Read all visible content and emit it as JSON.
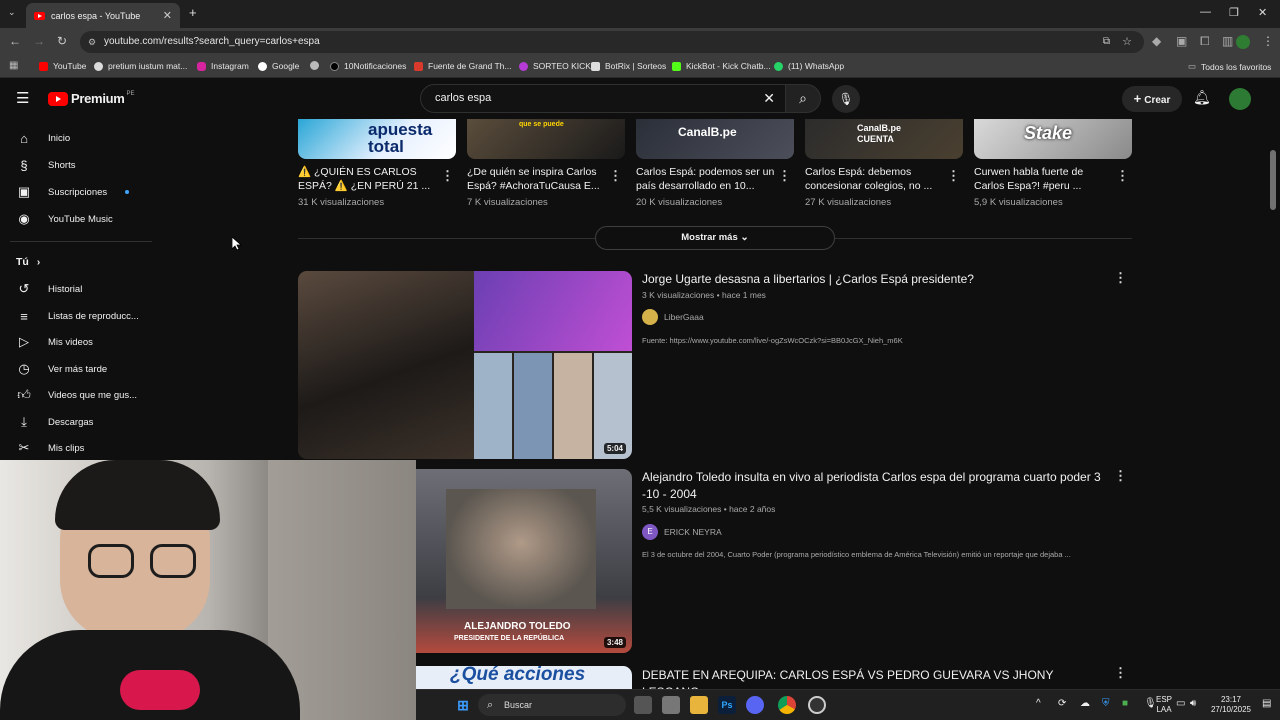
{
  "browser": {
    "tab_title": "carlos espa - YouTube",
    "url": "youtube.com/results?search_query=carlos+espa",
    "bookmarks": [
      "YouTube",
      "pretium iustum mat...",
      "Instagram",
      "Google",
      "10Notificaciones",
      "Fuente de Grand Th...",
      "SORTEO KICK",
      "BotRix | Sorteos",
      "KickBot - Kick Chatb...",
      "(11) WhatsApp"
    ],
    "all_bookmarks": "Todos los favoritos"
  },
  "youtube": {
    "logo": "Premium",
    "region": "PE",
    "search_query": "carlos espa",
    "create_label": "Crear",
    "sidebar": {
      "main": [
        "Inicio",
        "Shorts",
        "Suscripciones",
        "YouTube Music"
      ],
      "you_label": "Tú",
      "you_items": [
        "Historial",
        "Listas de reproducc...",
        "Mis videos",
        "Ver más tarde",
        "Videos que me gus...",
        "Descargas",
        "Mis clips"
      ]
    },
    "shelf": [
      {
        "title": "⚠️ ¿QUIÉN ES CARLOS ESPÁ? ⚠️ ¿EN PERÚ 21 ...",
        "views": "31 K visualizaciones",
        "thumb_text": "apuesta total"
      },
      {
        "title": "¿De quién se inspira Carlos Espá? #AchoraTuCausa E...",
        "views": "7 K visualizaciones",
        "thumb_text": "que se puede"
      },
      {
        "title": "Carlos Espá: podemos ser un país desarrollado en 10...",
        "views": "20 K visualizaciones",
        "thumb_text": "CanalB.pe"
      },
      {
        "title": "Carlos Espá: debemos concesionar colegios, no ...",
        "views": "27 K visualizaciones",
        "thumb_text": "CanalB.pe CUENTA"
      },
      {
        "title": "Curwen habla fuerte de Carlos Espa?! #peru ...",
        "views": "5,9 K visualizaciones",
        "thumb_text": "Stake"
      }
    ],
    "show_more": "Mostrar más",
    "videos": [
      {
        "title": "Jorge Ugarte desasna a libertarios | ¿Carlos Espá presidente?",
        "meta": "3 K visualizaciones • hace 1 mes",
        "channel": "LiberGaaa",
        "description": "Fuente: https://www.youtube.com/live/-ogZsWcOCzk?si=BB0JcGX_Nieh_m6K",
        "duration": "5:04"
      },
      {
        "title": "Alejandro Toledo insulta en vivo al periodista Carlos espa del programa cuarto poder 3 -10 - 2004",
        "meta": "5,5 K visualizaciones • hace 2 años",
        "channel": "ERICK NEYRA",
        "channel_initial": "E",
        "description": "El 3 de octubre del 2004, Cuarto Poder (programa periodístico emblema de América Televisión) emitió un reportaje que dejaba ...",
        "duration": "3:48",
        "thumb_caption_1": "ALEJANDRO TOLEDO",
        "thumb_caption_2": "PRESIDENTE DE LA REPÚBLICA"
      },
      {
        "title": "DEBATE EN AREQUIPA: CARLOS ESPÁ VS PEDRO GUEVARA VS JHONY LESCANO",
        "thumb_text": "¿Qué acciones"
      }
    ]
  },
  "taskbar": {
    "search_placeholder": "Buscar",
    "lang_1": "ESP",
    "lang_2": "LAA",
    "time": "23:17",
    "date": "27/10/2025"
  },
  "colors": {
    "yt_red": "#ff0000",
    "bg": "#0f0f0f",
    "accent_blue": "#3ea6ff"
  }
}
